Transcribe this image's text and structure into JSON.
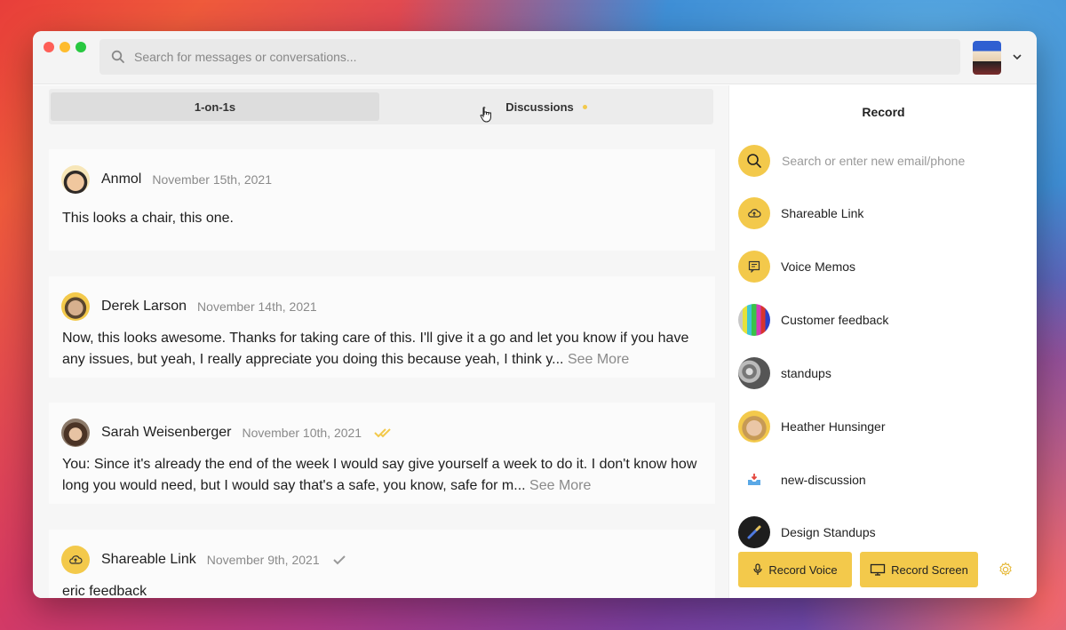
{
  "search": {
    "placeholder": "Search for messages or conversations..."
  },
  "tabs": [
    {
      "label": "1-on-1s",
      "active": true
    },
    {
      "label": "Discussions",
      "has_dot": true
    }
  ],
  "conversations": [
    {
      "name": "Anmol",
      "date": "November 15th, 2021",
      "message": "This looks a chair, this one.",
      "see_more": ""
    },
    {
      "name": "Derek Larson",
      "date": "November 14th, 2021",
      "message": "Now, this looks awesome. Thanks for taking care of this. I'll give it a go and let you know if you have any issues, but yeah, I really appreciate you doing this because yeah, I think y...",
      "see_more": "See More"
    },
    {
      "name": "Sarah Weisenberger",
      "date": "November 10th, 2021",
      "message": "You: Since it's already the end of the week I would say give yourself a week to do it. I don't know how long you would need, but I would say that's a safe, you know, safe for m...",
      "see_more": "See More",
      "status": "read"
    },
    {
      "name": "Shareable Link",
      "date": "November 9th, 2021",
      "message": "eric feedback",
      "see_more": "",
      "status": "sent"
    }
  ],
  "record_panel": {
    "title": "Record",
    "search_placeholder": "Search or enter new email/phone",
    "items": [
      {
        "label": "Shareable Link",
        "icon": "cloud-upload-icon"
      },
      {
        "label": "Voice Memos",
        "icon": "note-icon"
      },
      {
        "label": "Customer feedback",
        "icon": "color-bars-avatar"
      },
      {
        "label": "standups",
        "icon": "group-photo-avatar"
      },
      {
        "label": "Heather Hunsinger",
        "icon": "person-avatar"
      },
      {
        "label": "new-discussion",
        "icon": "inbox-icon"
      },
      {
        "label": "Design Standups",
        "icon": "pen-avatar"
      }
    ],
    "record_voice": "Record Voice",
    "record_screen": "Record Screen"
  },
  "colors": {
    "accent": "#f3c94b",
    "tab_dot": "#f2c94c",
    "read_check": "#f2c94c",
    "sent_check": "#999999"
  }
}
